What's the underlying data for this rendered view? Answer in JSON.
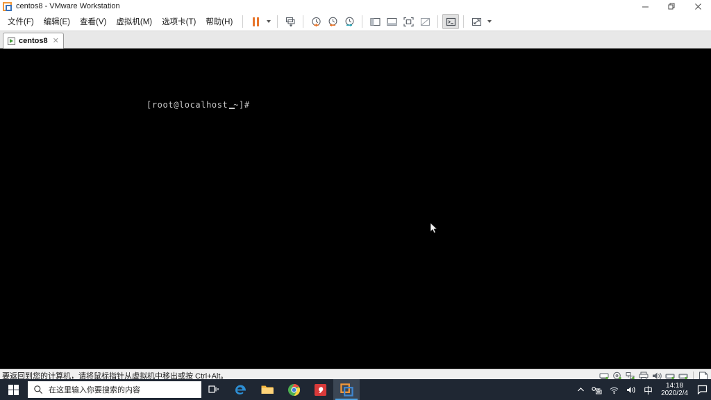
{
  "window": {
    "title": "centos8 - VMware Workstation",
    "logo_icon": "vmware-logo-icon",
    "controls": {
      "minimize": "—",
      "maximize": "❐",
      "close": "✕"
    }
  },
  "menubar": {
    "items": [
      {
        "label": "文件(F)",
        "name": "menu-file"
      },
      {
        "label": "编辑(E)",
        "name": "menu-edit"
      },
      {
        "label": "查看(V)",
        "name": "menu-view"
      },
      {
        "label": "虚拟机(M)",
        "name": "menu-vm"
      },
      {
        "label": "选项卡(T)",
        "name": "menu-tabs"
      },
      {
        "label": "帮助(H)",
        "name": "menu-help"
      }
    ]
  },
  "toolbar": {
    "buttons": [
      {
        "name": "suspend-button",
        "icon": "pause-icon"
      },
      {
        "name": "power-dropdown",
        "icon": "chevron-down-icon"
      },
      {
        "name": "manage-snapshots-button",
        "icon": "snapshot-manager-icon"
      },
      {
        "name": "take-snapshot-button",
        "icon": "snapshot-add-icon"
      },
      {
        "name": "revert-snapshot-button",
        "icon": "snapshot-revert-icon"
      },
      {
        "name": "snapshot-manager-button",
        "icon": "snapshot-clock-icon"
      },
      {
        "name": "show-library-button",
        "icon": "library-panel-icon"
      },
      {
        "name": "show-thumbnails-button",
        "icon": "thumbnail-bar-icon"
      },
      {
        "name": "enter-fullscreen-button",
        "icon": "fullscreen-icon"
      },
      {
        "name": "unity-mode-button",
        "icon": "unity-mode-icon"
      },
      {
        "name": "console-view-button",
        "icon": "console-icon"
      },
      {
        "name": "stretch-view-button",
        "icon": "stretch-icon"
      },
      {
        "name": "stretch-dropdown",
        "icon": "chevron-down-icon"
      }
    ]
  },
  "tabbar": {
    "tabs": [
      {
        "label": "centos8",
        "icon": "vm-powered-on-icon",
        "close": "✕",
        "active": true
      }
    ]
  },
  "vm_screen": {
    "terminal_prompt": "[root@localhost ~]#",
    "cursor_icon": "mouse-pointer-icon",
    "background_color": "#000000",
    "text_color": "#c8c8c8"
  },
  "vm_statusbar": {
    "message": "要返回到您的计算机，请将鼠标指针从虚拟机中移出或按 Ctrl+Alt。",
    "devices": [
      {
        "name": "hard-disk-icon"
      },
      {
        "name": "cd-dvd-icon"
      },
      {
        "name": "network-adapter-icon"
      },
      {
        "name": "printer-icon"
      },
      {
        "name": "sound-card-icon"
      },
      {
        "name": "usb-device-icon"
      },
      {
        "name": "usb-device-2-icon"
      },
      {
        "name": "message-log-icon"
      }
    ]
  },
  "taskbar": {
    "start_icon": "windows-start-icon",
    "search": {
      "placeholder": "在这里输入你要搜索的内容",
      "icon": "search-icon"
    },
    "apps": [
      {
        "name": "task-view-button",
        "icon": "task-view-icon",
        "active": false
      },
      {
        "name": "edge-button",
        "icon": "edge-icon",
        "active": false
      },
      {
        "name": "file-explorer-button",
        "icon": "folder-icon",
        "active": false
      },
      {
        "name": "chrome-button",
        "icon": "chrome-icon",
        "active": false
      },
      {
        "name": "wps-button",
        "icon": "wps-icon",
        "active": false
      },
      {
        "name": "vmware-taskbar-button",
        "icon": "vmware-logo-icon",
        "active": true
      }
    ],
    "tray": {
      "overflow_icon": "chevron-up-icon",
      "security_icon": "network-key-icon",
      "wifi_icon": "wifi-icon",
      "volume_icon": "speaker-icon",
      "ime_label": "中",
      "time": "14:18",
      "date": "2020/2/4",
      "notification_icon": "action-center-icon"
    }
  },
  "colors": {
    "accent_orange": "#e8762c",
    "accent_blue": "#3a72b8",
    "taskbar_bg": "#1f2733",
    "vm_bg": "#000000"
  }
}
